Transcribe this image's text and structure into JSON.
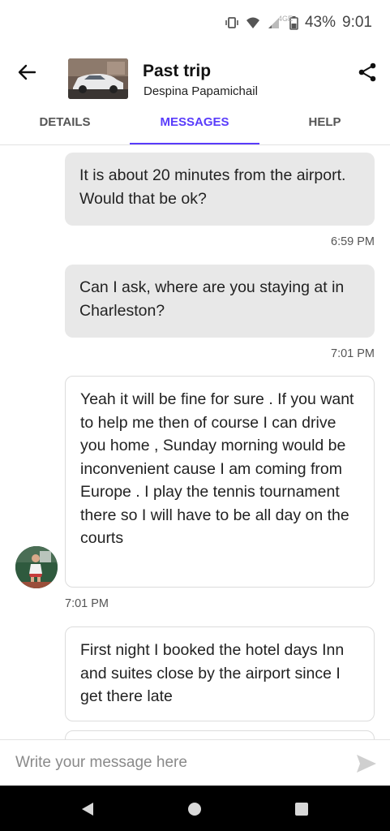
{
  "status_bar": {
    "network_label": "4GE",
    "battery": "43%",
    "time": "9:01",
    "icons": [
      "vibrate-icon",
      "wifi-icon",
      "signal-icon",
      "battery-icon"
    ]
  },
  "header": {
    "title": "Past trip",
    "host_name": "Despina Papamichail",
    "back_icon": "arrow-left-icon",
    "share_icon": "share-icon"
  },
  "tabs": [
    {
      "label": "DETAILS",
      "active": false
    },
    {
      "label": "MESSAGES",
      "active": true
    },
    {
      "label": "HELP",
      "active": false
    }
  ],
  "messages": [
    {
      "direction": "sent",
      "text": "It is about 20 minutes from the airport. Would that be ok?",
      "time": "6:59 PM"
    },
    {
      "direction": "sent",
      "text": "Can I ask, where are you staying at in Charleston?",
      "time": "7:01 PM"
    },
    {
      "direction": "received",
      "text": "Yeah it will be fine for sure . If you want to help me then of course I can drive you home , Sunday morning would be inconvenient cause I am coming from Europe . I play the tennis tournament there so I will have to be all day on the courts",
      "time": "7:01 PM"
    },
    {
      "direction": "received",
      "text": "First night I booked the hotel days Inn and suites close by the airport since I get there late",
      "time": ""
    }
  ],
  "composer": {
    "placeholder": "Write your message here",
    "value": ""
  },
  "colors": {
    "accent": "#593cfb",
    "sent_bubble": "#e8e8e8",
    "received_border": "#dcdcdc"
  }
}
